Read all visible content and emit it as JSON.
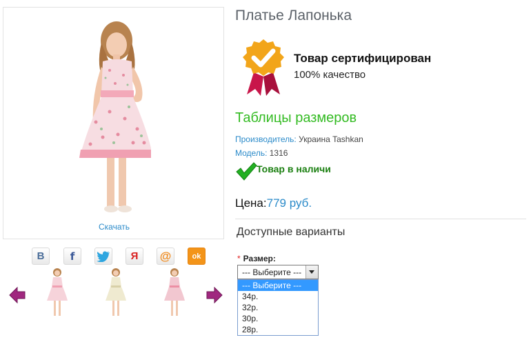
{
  "gallery": {
    "download_label": "Скачать",
    "social": [
      {
        "name": "vkontakte-icon",
        "glyph": "В",
        "color": "#4a6d99"
      },
      {
        "name": "facebook-icon",
        "glyph": "f",
        "color": "#3b5998"
      },
      {
        "name": "twitter-icon",
        "glyph": "",
        "color": "#2fa6e0"
      },
      {
        "name": "yaru-icon",
        "glyph": "Я",
        "color": "#d92020"
      },
      {
        "name": "mailru-icon",
        "glyph": "@",
        "color": "#f08a1c"
      },
      {
        "name": "odnoklassniki-icon",
        "glyph": "ok",
        "color": "#ffffff"
      }
    ],
    "thumbs": [
      "dress-pink",
      "dress-cream",
      "dress-pink-2"
    ]
  },
  "product": {
    "title": "Платье Лапонька",
    "cert_title": "Товар сертифицирован",
    "cert_subtitle": "100% качество",
    "size_table_link": "Таблицы размеров",
    "manufacturer_label": "Производитель:",
    "manufacturer_value": "Украина Tashkan",
    "model_label": "Модель:",
    "model_value": "1316",
    "stock": "Товар в наличи",
    "price_label": "Цена:",
    "price_value": "779 руб."
  },
  "variants": {
    "title": "Доступные варианты",
    "required_mark": "*",
    "size_label": "Размер:",
    "select_value": "--- Выберите ---",
    "options": [
      "--- Выберите ---",
      "34р.",
      "32р.",
      "30р.",
      "28р."
    ]
  }
}
